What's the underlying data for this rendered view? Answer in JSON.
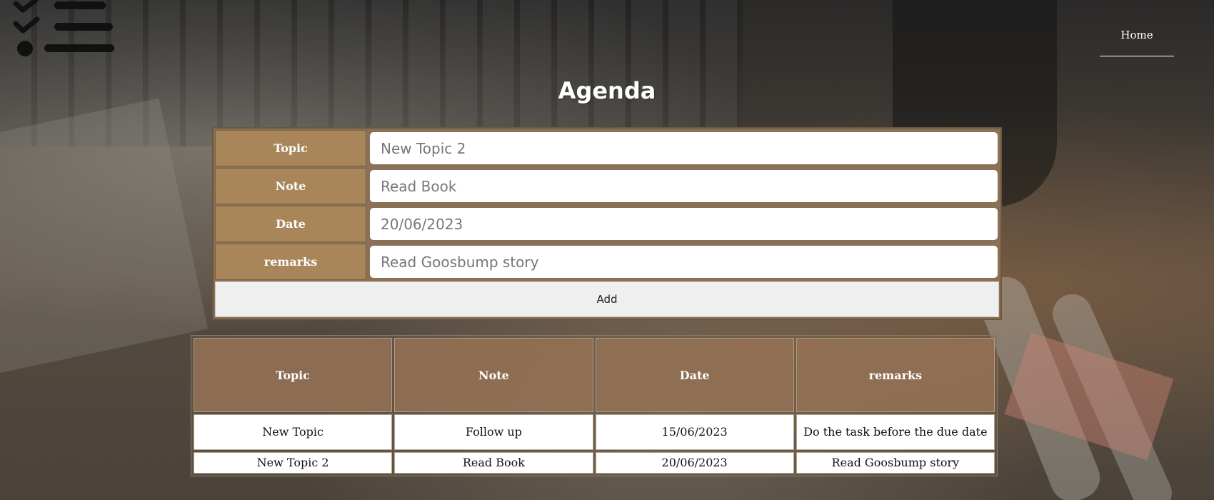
{
  "nav": {
    "home_label": "Home"
  },
  "logo": {
    "icon": "checklist-icon"
  },
  "page": {
    "title": "Agenda"
  },
  "form": {
    "fields": [
      {
        "label": "Topic",
        "value": "New Topic 2"
      },
      {
        "label": "Note",
        "value": "Read Book"
      },
      {
        "label": "Date",
        "value": "20/06/2023"
      },
      {
        "label": "remarks",
        "value": "Read Goosbump story"
      }
    ],
    "add_label": "Add"
  },
  "table": {
    "headers": [
      "Topic",
      "Note",
      "Date",
      "remarks"
    ],
    "rows": [
      [
        "New Topic",
        "Follow up",
        "15/06/2023",
        "Do the task before the due date"
      ],
      [
        "New Topic 2",
        "Read Book",
        "20/06/2023",
        "Read Goosbump story"
      ]
    ]
  },
  "colors": {
    "label_bg": "#a8865a",
    "header_bg": "#96735a",
    "title": "#ffffff"
  }
}
